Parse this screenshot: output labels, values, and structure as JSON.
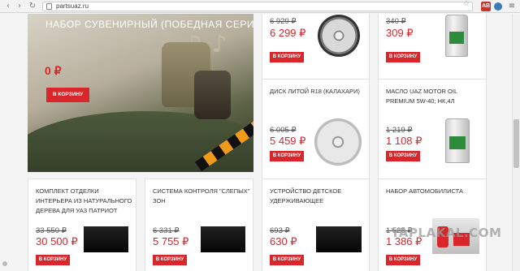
{
  "browser": {
    "url_host": "partsuaz.ru",
    "star_icon": "☆",
    "ext_badge": "AB"
  },
  "banner": {
    "title": "НАБОР СУВЕНИРНЫЙ (ПОБЕДНАЯ СЕРИЯ)",
    "price": "0 ₽",
    "button": "В КОРЗИНУ"
  },
  "products": [
    {
      "name": "",
      "old_price": "6 929 ₽",
      "price": "6 299 ₽",
      "button": "В КОРЗИНУ"
    },
    {
      "name": "",
      "old_price": "340 ₽",
      "price": "309 ₽",
      "button": "В КОРЗИНУ"
    },
    {
      "name": "ДИСК ЛИТОЙ  R18 (КАЛАХАРИ)",
      "old_price": "6 005 ₽",
      "price": "5 459 ₽",
      "button": "В КОРЗИНУ"
    },
    {
      "name": "МАСЛО UAZ MOTOR OIL PREMIUM 5W-40; НК,4Л",
      "old_price": "1 219 ₽",
      "price": "1 108 ₽",
      "button": "В КОРЗИНУ"
    },
    {
      "name": "КОМПЛЕКТ ОТДЕЛКИ ИНТЕРЬЕРА ИЗ НАТУРАЛЬНОГО ДЕРЕВА ДЛЯ УАЗ ПАТРИОТ",
      "old_price": "33 550 ₽",
      "price": "30 500 ₽",
      "button": "В КОРЗИНУ"
    },
    {
      "name": "СИСТЕМА КОНТРОЛЯ \"СЛЕПЫХ\" ЗОН",
      "old_price": "6 331 ₽",
      "price": "5 755 ₽",
      "button": "В КОРЗИНУ"
    },
    {
      "name": "УСТРОЙСТВО ДЕТСКОЕ УДЕРЖИВАЮЩЕЕ",
      "old_price": "693 ₽",
      "price": "630 ₽",
      "button": "В КОРЗИНУ"
    },
    {
      "name": "НАБОР АВТОМОБИЛИСТА",
      "old_price": "1 525 ₽",
      "price": "1 386 ₽",
      "button": "В КОРЗИНУ"
    }
  ],
  "watermark": "YAPLAKAL.COM"
}
